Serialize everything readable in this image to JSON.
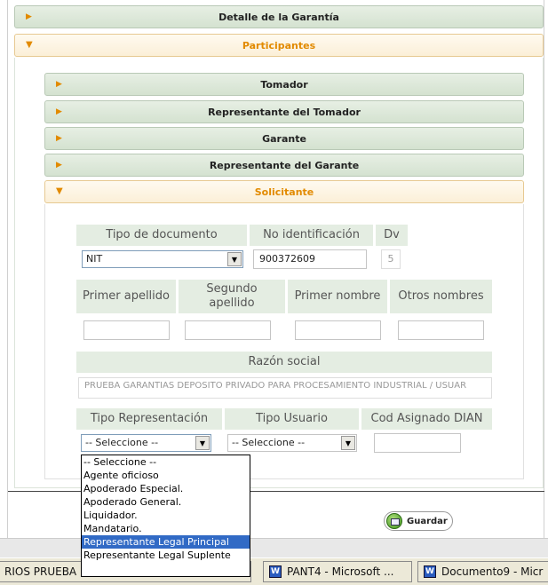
{
  "sections": {
    "detalle": "Detalle de la Garantía",
    "participantes": "Participantes"
  },
  "sub_sections": {
    "tomador": "Tomador",
    "rep_tomador": "Representante del Tomador",
    "garante": "Garante",
    "rep_garante": "Representante del Garante",
    "solicitante": "Solicitante"
  },
  "form": {
    "tipo_documento_label": "Tipo de documento",
    "no_identificacion_label": "No identificación",
    "dv_label": "Dv",
    "tipo_documento_value": "NIT",
    "no_identificacion_value": "900372609",
    "dv_value": "5",
    "primer_apellido_label": "Primer apellido",
    "segundo_apellido_label": "Segundo apellido",
    "primer_nombre_label": "Primer nombre",
    "otros_nombres_label": "Otros nombres",
    "razon_social_label": "Razón social",
    "razon_social_value": "PRUEBA GARANTIAS DEPOSITO PRIVADO PARA PROCESAMIENTO INDUSTRIAL / USUAR",
    "tipo_representacion_label": "Tipo Representación",
    "tipo_usuario_label": "Tipo Usuario",
    "cod_dian_label": "Cod Asignado DIAN",
    "tipo_representacion_value": "-- Seleccione --",
    "tipo_usuario_value": "-- Seleccione --"
  },
  "dropdown_options": [
    "-- Seleccione --",
    "Agente oficioso",
    "Apoderado Especial.",
    "Apoderado General.",
    "Liquidador.",
    "Mandatario.",
    "Representante Legal Principal",
    "Representante Legal Suplente"
  ],
  "dropdown_selected": "Representante Legal Principal",
  "buttons": {
    "guardar": "Guardar"
  },
  "taskbar": {
    "item1": "RIOS PRUEBA",
    "item2": "PANT4 - Microsoft ...",
    "item3": "Documento9 - Micr"
  },
  "colors": {
    "header_bg": "#d4e2d0",
    "active_text": "#e28a00",
    "selected_option": "#316ac5"
  }
}
